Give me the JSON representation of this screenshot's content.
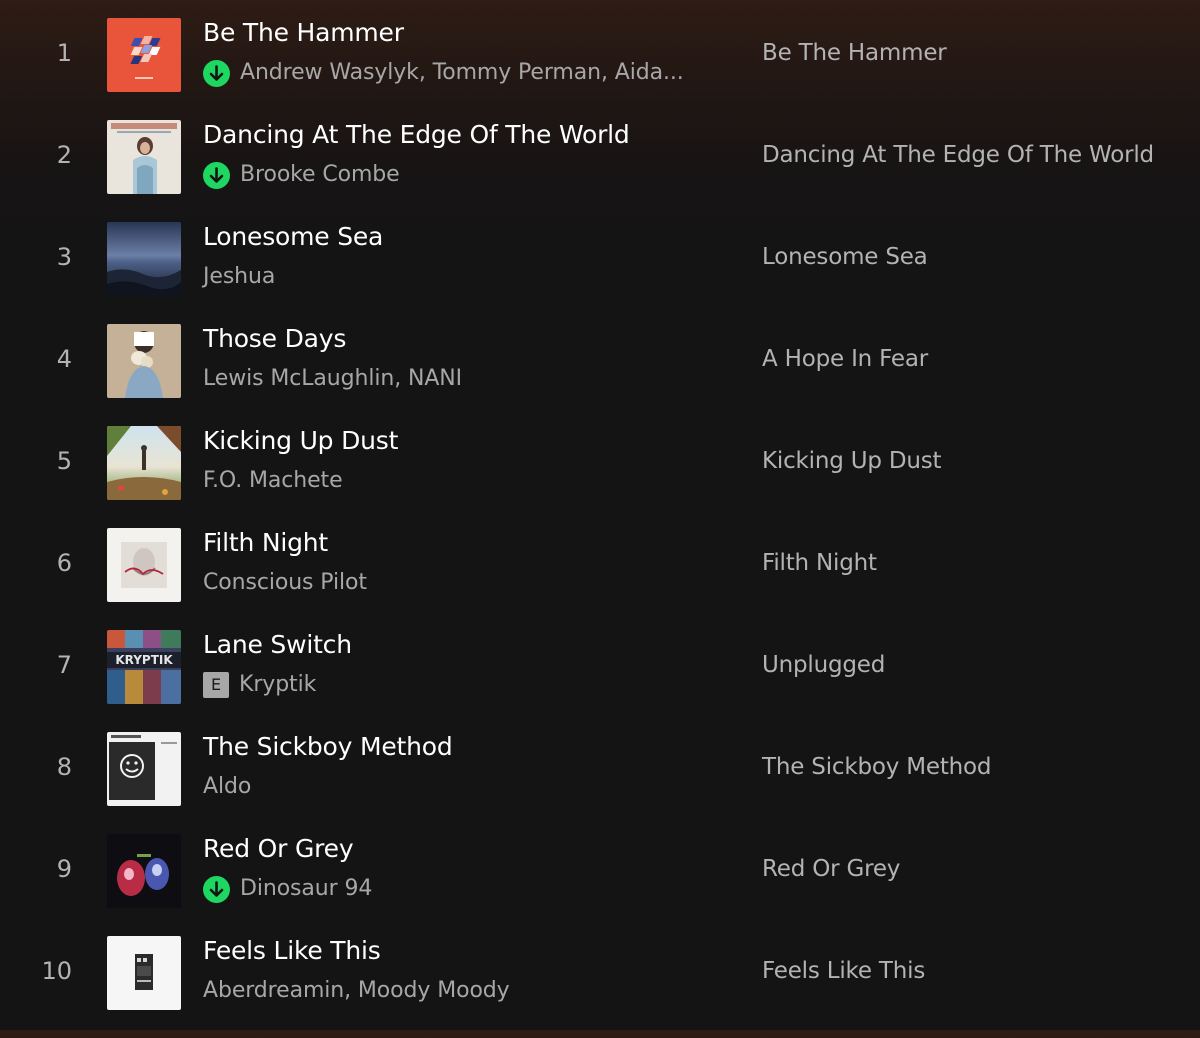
{
  "tracks": [
    {
      "num": "1",
      "title": "Be The Hammer",
      "artist": "Andrew Wasylyk, Tommy Perman, Aida...",
      "album": "Be The Hammer",
      "downloaded": true,
      "explicit": false
    },
    {
      "num": "2",
      "title": "Dancing At The Edge Of The World",
      "artist": "Brooke Combe",
      "album": "Dancing At The Edge Of The World",
      "downloaded": true,
      "explicit": false
    },
    {
      "num": "3",
      "title": "Lonesome Sea",
      "artist": "Jeshua",
      "album": "Lonesome Sea",
      "downloaded": false,
      "explicit": false
    },
    {
      "num": "4",
      "title": "Those Days",
      "artist": "Lewis McLaughlin, NANI",
      "album": "A Hope In Fear",
      "downloaded": false,
      "explicit": false
    },
    {
      "num": "5",
      "title": "Kicking Up Dust",
      "artist": "F.O. Machete",
      "album": "Kicking Up Dust",
      "downloaded": false,
      "explicit": false
    },
    {
      "num": "6",
      "title": "Filth Night",
      "artist": "Conscious Pilot",
      "album": "Filth Night",
      "downloaded": false,
      "explicit": false
    },
    {
      "num": "7",
      "title": "Lane Switch",
      "artist": "Kryptik",
      "album": "Unplugged",
      "downloaded": false,
      "explicit": true,
      "explicit_label": "E"
    },
    {
      "num": "8",
      "title": "The Sickboy Method",
      "artist": "Aldo",
      "album": "The Sickboy Method",
      "downloaded": false,
      "explicit": false
    },
    {
      "num": "9",
      "title": "Red Or Grey",
      "artist": "Dinosaur 94",
      "album": "Red Or Grey",
      "downloaded": true,
      "explicit": false
    },
    {
      "num": "10",
      "title": "Feels Like This",
      "artist": "Aberdreamin, Moody Moody",
      "album": "Feels Like This",
      "downloaded": false,
      "explicit": false
    }
  ],
  "cover_text": {
    "cover_7": "KRYPTIK"
  },
  "colors": {
    "download_green": "#1ed760",
    "primary_text": "#ffffff",
    "secondary_text": "#a7a7a7"
  },
  "icons": {
    "download": "download-arrow-icon",
    "explicit": "explicit-badge"
  }
}
